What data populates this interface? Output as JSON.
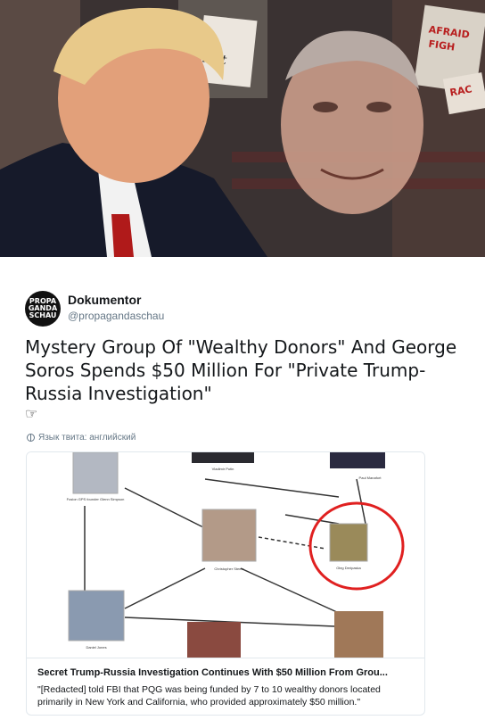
{
  "tweet": {
    "author_name": "Dokumentor",
    "author_handle": "@propagandaschau",
    "avatar_lines": [
      "PROPA",
      "GANDA",
      "SCHAU"
    ],
    "text": "Mystery Group Of \"Wealthy Donors\" And George Soros Spends $50 Million For \"Private Trump-Russia Investigation\"",
    "emoji": "☞",
    "language_label": "Язык твита: английский"
  },
  "hero": {
    "sign_texts": [
      "ient",
      "AFRAID",
      "FIGH",
      "RAC"
    ]
  },
  "card": {
    "diagram_captions": {
      "fusion": "Fusion GPS founder Glenn Simpson",
      "putin": "Vladimir Putin",
      "manafort": "Paul Manafort",
      "steele": "Christopher Steele",
      "deripaska": "Oleg Deripaska",
      "jones": "Daniel Jones"
    },
    "title": "Secret Trump-Russia Investigation Continues With $50 Million From Grou...",
    "description": "\"[Redacted] told FBI that PQG was being funded by 7 to 10 wealthy donors located primarily in New York and California, who provided approximately $50 million.\""
  },
  "colors": {
    "highlight_circle": "#e02020",
    "link_text": "#14171a",
    "secondary_text": "#657786"
  }
}
